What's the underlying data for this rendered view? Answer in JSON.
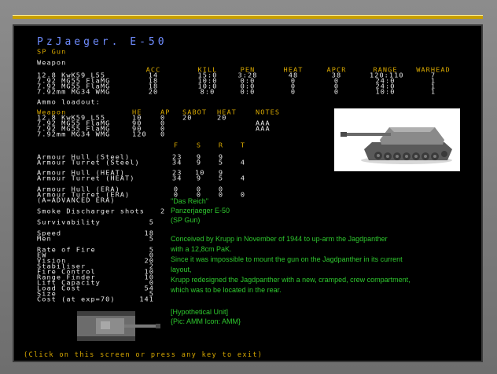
{
  "unit": {
    "name": "PzJaeger. E-50",
    "type": "SP Gun"
  },
  "weapons_table": {
    "title": "Weapon",
    "headers": [
      "ACC",
      "KILL",
      "PEN",
      "HEAT",
      "APCR",
      "RANGE",
      "WARHEAD"
    ],
    "rows": [
      {
        "name": "12.8 KwK59 L55",
        "acc": "14",
        "kill": "15:0",
        "pen": "3:28",
        "heat": "48",
        "apcr": "38",
        "range": "120:110",
        "warhead": "7"
      },
      {
        "name": "7.92 MG55 FlaMG",
        "acc": "18",
        "kill": "10:0",
        "pen": "0:0",
        "heat": "0",
        "apcr": "0",
        "range": "24:0",
        "warhead": "1"
      },
      {
        "name": "7.92 MG55 FlaMG",
        "acc": "18",
        "kill": "10:0",
        "pen": "0:0",
        "heat": "0",
        "apcr": "0",
        "range": "24:0",
        "warhead": "1"
      },
      {
        "name": "7.92mm MG34 WMG",
        "acc": "20",
        "kill": "8:0",
        "pen": "0:0",
        "heat": "0",
        "apcr": "0",
        "range": "10:0",
        "warhead": "1"
      }
    ]
  },
  "ammo": {
    "title": "Ammo loadout:",
    "headers": [
      "Weapon",
      "HE",
      "AP",
      "SABOT",
      "HEAT",
      "NOTES"
    ],
    "rows": [
      {
        "name": "12.8 KwK59 L55",
        "he": "10",
        "ap": "0",
        "sabot": "20",
        "heat": "20",
        "notes": ""
      },
      {
        "name": "7.92 MG55 FlaMG",
        "he": "90",
        "ap": "0",
        "sabot": "",
        "heat": "",
        "notes": "AAA"
      },
      {
        "name": "7.92 MG55 FlaMG",
        "he": "90",
        "ap": "0",
        "sabot": "",
        "heat": "",
        "notes": "AAA"
      },
      {
        "name": "7.92mm MG34 WMG",
        "he": "120",
        "ap": "0",
        "sabot": "",
        "heat": "",
        "notes": ""
      }
    ]
  },
  "armour": {
    "headers": [
      "F",
      "S",
      "R",
      "T"
    ],
    "rows": [
      {
        "label": "Armour Hull (Steel)",
        "f": "23",
        "s": "9",
        "r": "9",
        "t": ""
      },
      {
        "label": "Armour Turret (Steel)",
        "f": "34",
        "s": "9",
        "r": "5",
        "t": "4"
      },
      {
        "label": "Armour Hull (HEAT)",
        "f": "23",
        "s": "10",
        "r": "9",
        "t": ""
      },
      {
        "label": "Armour Turret (HEAT)",
        "f": "34",
        "s": "9",
        "r": "5",
        "t": "4"
      },
      {
        "label": "Armour Hull (ERA)",
        "f": "0",
        "s": "0",
        "r": "0",
        "t": ""
      },
      {
        "label": "Armour Turret (ERA)",
        "f": "0",
        "s": "0",
        "r": "0",
        "t": "0"
      }
    ],
    "advanced_note": "(A=ADVANCED ERA)"
  },
  "stats": {
    "smoke": {
      "label": "Smoke Discharger shots",
      "value": "2"
    },
    "survivability": {
      "label": "Survivability",
      "value": "5"
    },
    "list1": [
      {
        "label": "Speed",
        "value": "18"
      },
      {
        "label": "Men",
        "value": "5"
      }
    ],
    "list2": [
      {
        "label": "Rate of Fire",
        "value": "5"
      },
      {
        "label": "EW",
        "value": "0"
      },
      {
        "label": "Vision",
        "value": "20"
      },
      {
        "label": "Stabiliser",
        "value": "2"
      },
      {
        "label": "Fire Control",
        "value": "10"
      },
      {
        "label": "Range Finder",
        "value": "10"
      },
      {
        "label": "Lift Capacity",
        "value": "0"
      },
      {
        "label": "Load Cost",
        "value": "54"
      },
      {
        "label": "Size",
        "value": "5"
      },
      {
        "label": "Cost (at exp=70)",
        "value": "141"
      }
    ]
  },
  "description": {
    "line1": "\"Das Reich\"",
    "line2": "Panzerjaeger E-50",
    "line3": "(SP Gun)",
    "para": [
      "Conceived by Krupp in November of 1944 to up-arm the Jagdpanther",
      "with a 12,8cm PaK.",
      "Since it was impossible to mount the gun on the Jagdpanther in its current",
      "layout,",
      "Krupp redesigned the Jagdpanther with a new, cramped, crew compartment,",
      "which was to be located in the rear."
    ],
    "hypo": "[Hypothetical Unit]",
    "credit": "{Pic: AMM Icon: AMM}"
  },
  "footer": "(Click on this screen or press any key to exit)",
  "colors": {
    "title": "#6f8cff",
    "header": "#d8a800",
    "text": "#e8e8e8",
    "desc": "#2ec82e",
    "frame": "#7a7a7a",
    "bar": "#c8a000"
  }
}
